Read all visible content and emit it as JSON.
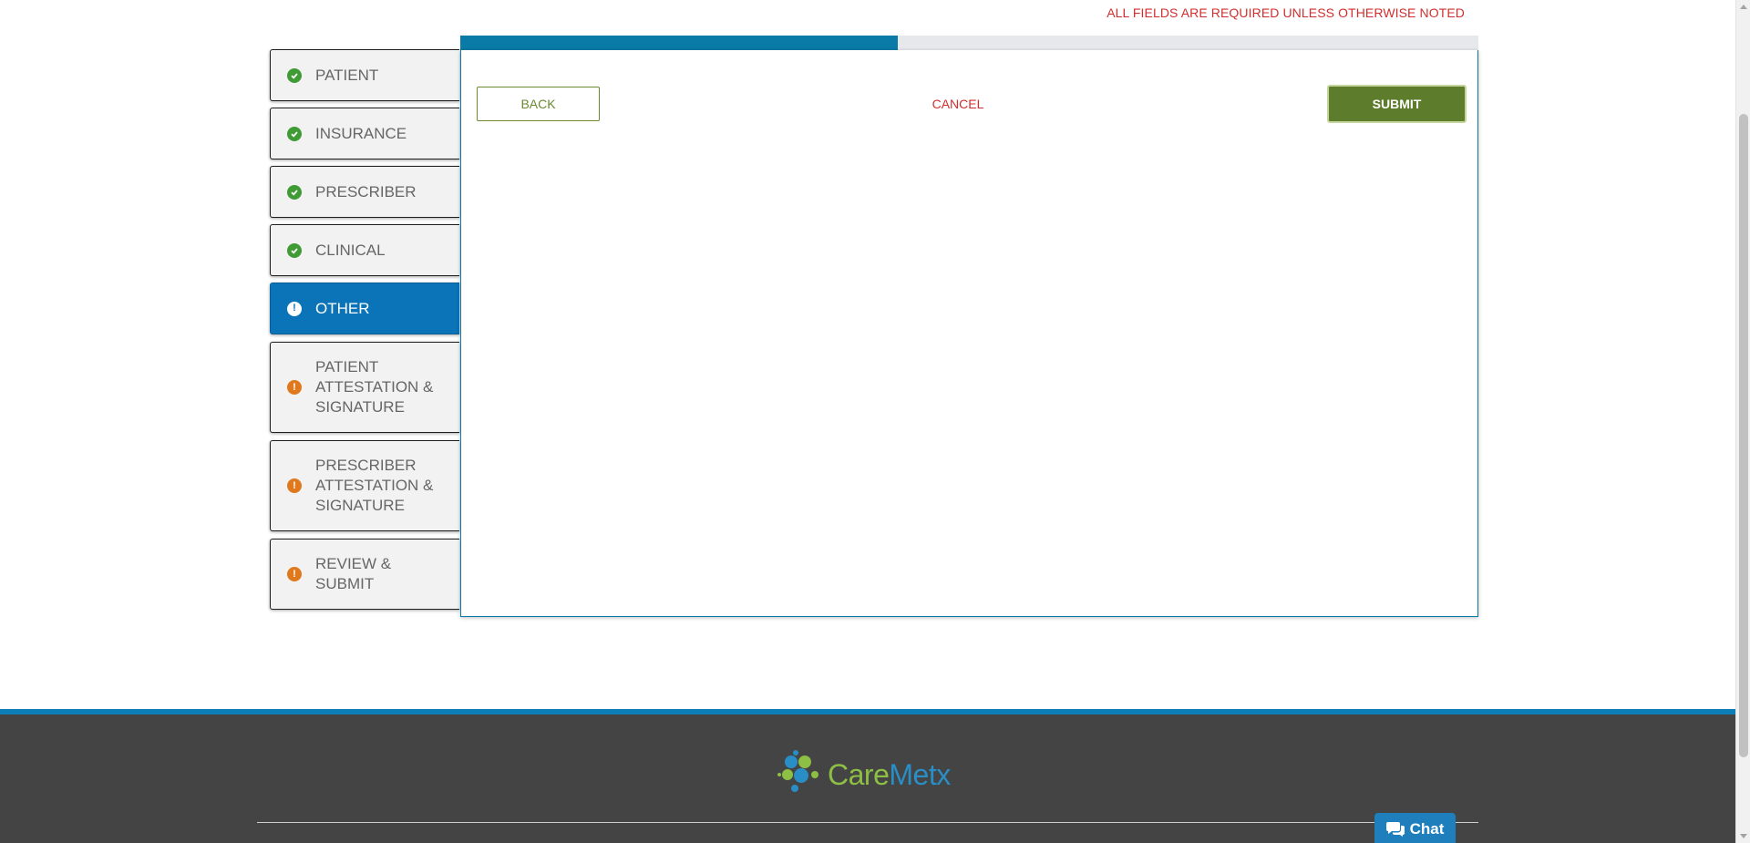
{
  "header": {
    "required_note": "ALL FIELDS ARE REQUIRED UNLESS OTHERWISE NOTED"
  },
  "progress": {
    "fraction": 0.43
  },
  "sidebar": {
    "steps": [
      {
        "label": "PATIENT",
        "status": "complete",
        "icon": "check-circle-icon"
      },
      {
        "label": "INSURANCE",
        "status": "complete",
        "icon": "check-circle-icon"
      },
      {
        "label": "PRESCRIBER",
        "status": "complete",
        "icon": "check-circle-icon"
      },
      {
        "label": "CLINICAL",
        "status": "complete",
        "icon": "check-circle-icon"
      },
      {
        "label": "OTHER",
        "status": "active",
        "icon": "exclamation-circle-icon"
      },
      {
        "label": "PATIENT ATTESTATION & SIGNATURE",
        "status": "incomplete",
        "icon": "exclamation-circle-icon"
      },
      {
        "label": "PRESCRIBER ATTESTATION & SIGNATURE",
        "status": "incomplete",
        "icon": "exclamation-circle-icon"
      },
      {
        "label": "REVIEW & SUBMIT",
        "status": "incomplete",
        "icon": "exclamation-circle-icon"
      }
    ]
  },
  "actions": {
    "back_label": "BACK",
    "cancel_label": "CANCEL",
    "submit_label": "SUBMIT"
  },
  "footer": {
    "logo_care": "Care",
    "logo_metx": "Metx",
    "chat_label": "Chat",
    "chat_icon": "chat-bubbles-icon"
  },
  "colors": {
    "accent_blue": "#0b73b7",
    "progress_blue": "#0a7aa7",
    "submit_green": "#5e7d2c",
    "error_red": "#d12f2f",
    "complete_green": "#3f9c35",
    "warning_orange": "#e0791d"
  }
}
